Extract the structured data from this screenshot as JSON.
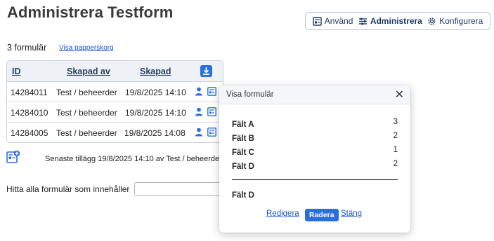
{
  "header": {
    "title": "Administrera Testform"
  },
  "topnav": {
    "items": [
      {
        "label": "Använd",
        "icon": "form-icon",
        "active": false
      },
      {
        "label": "Administrera",
        "icon": "sliders-icon",
        "active": true
      },
      {
        "label": "Konfigurera",
        "icon": "gear-icon",
        "active": false
      }
    ]
  },
  "summary": {
    "count_text": "3 formulär",
    "trash_link": "Visa papperskorg"
  },
  "table": {
    "headers": {
      "id": "ID",
      "created_by": "Skapad av",
      "created": "Skapad"
    },
    "rows": [
      {
        "id": "14284011",
        "created_by": "Test / beheerder",
        "created": "19/8/2025 14:10"
      },
      {
        "id": "14284010",
        "created_by": "Test / beheerder",
        "created": "19/8/2025 14:10"
      },
      {
        "id": "14284005",
        "created_by": "Test / beheerder",
        "created": "19/8/2025 14:08"
      }
    ]
  },
  "footer": {
    "latest_text": "Senaste tillägg 19/8/2025 14:10 av Test / beheerder"
  },
  "search": {
    "label": "Hitta alla formulär som innehåller",
    "value": "",
    "placeholder": ""
  },
  "modal": {
    "title": "Visa formulär",
    "close_glyph": "✕",
    "fields": [
      {
        "name": "Fält A",
        "value": "3"
      },
      {
        "name": "Fält B",
        "value": "2"
      },
      {
        "name": "Fält C",
        "value": "1"
      },
      {
        "name": "Fält D",
        "value": "2"
      }
    ],
    "summary_label": "Fält D",
    "actions": {
      "edit": "Redigera",
      "delete": "Radera",
      "close": "Stäng"
    }
  },
  "colors": {
    "accent": "#2a6fdb",
    "link": "#1a55c8",
    "nav_text": "#1f3a6a"
  }
}
